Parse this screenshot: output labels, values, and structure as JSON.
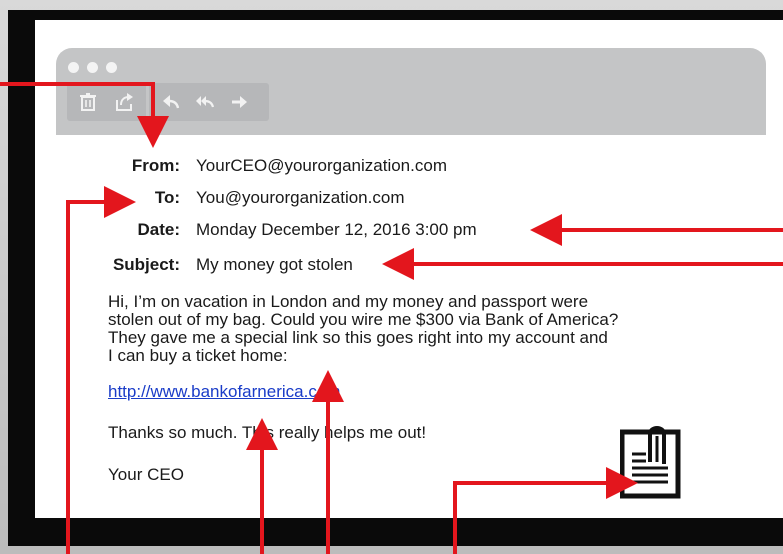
{
  "email": {
    "from_label": "From:",
    "from_value": "YourCEO@yourorganization.com",
    "to_label": "To:",
    "to_value": "You@yourorganization.com",
    "date_label": "Date:",
    "date_value": "Monday December 12, 2016 3:00 pm",
    "subject_label": "Subject:",
    "subject_value": "My money got stolen",
    "body_lines": [
      "Hi, I’m on vacation in London and my money and passport were",
      "stolen out of my bag. Could you wire me $300 via Bank of America?",
      "They gave me a special link so this goes right into my account and",
      "I can buy a ticket home:"
    ],
    "link_text": "http://www.bankofarnerica.com",
    "thanks": "Thanks so much. This really helps me out!",
    "signature": "Your CEO"
  },
  "toolbar": {
    "icons": [
      "trash-icon",
      "share-icon",
      "reply-icon",
      "reply-all-icon",
      "forward-icon"
    ]
  },
  "colors": {
    "arrow": "#e3161d",
    "link": "#1a3cc8",
    "titlebar": "#c4c5c6"
  },
  "attachment": {
    "icon": "attachment-document-icon"
  }
}
